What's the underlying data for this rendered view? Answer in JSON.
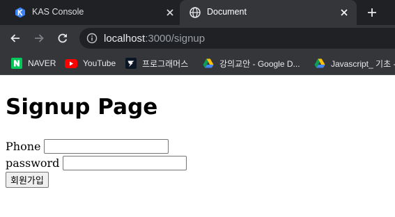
{
  "browser": {
    "tabs": [
      {
        "title": "KAS Console",
        "active": false
      },
      {
        "title": "Document",
        "active": true
      }
    ],
    "address_bar": {
      "host": "localhost",
      "path": ":3000/signup"
    },
    "bookmarks": [
      {
        "label": "NAVER",
        "icon": "naver-icon"
      },
      {
        "label": "YouTube",
        "icon": "youtube-icon"
      },
      {
        "label": "프로그래머스",
        "icon": "programmers-icon"
      },
      {
        "label": "강의교안 - Google D...",
        "icon": "google-drive-icon"
      },
      {
        "label": "Javascript_ 기초 -",
        "icon": "google-drive-icon"
      }
    ],
    "colors": {
      "tabstrip": "#202124",
      "toolbar": "#35363a",
      "naver": "#03c75a",
      "youtube": "#ff0000"
    }
  },
  "page": {
    "heading": "Signup Page",
    "fields": {
      "phone": {
        "label": "Phone",
        "value": ""
      },
      "password": {
        "label": "password",
        "value": ""
      }
    },
    "submit_label": "회원가입"
  }
}
